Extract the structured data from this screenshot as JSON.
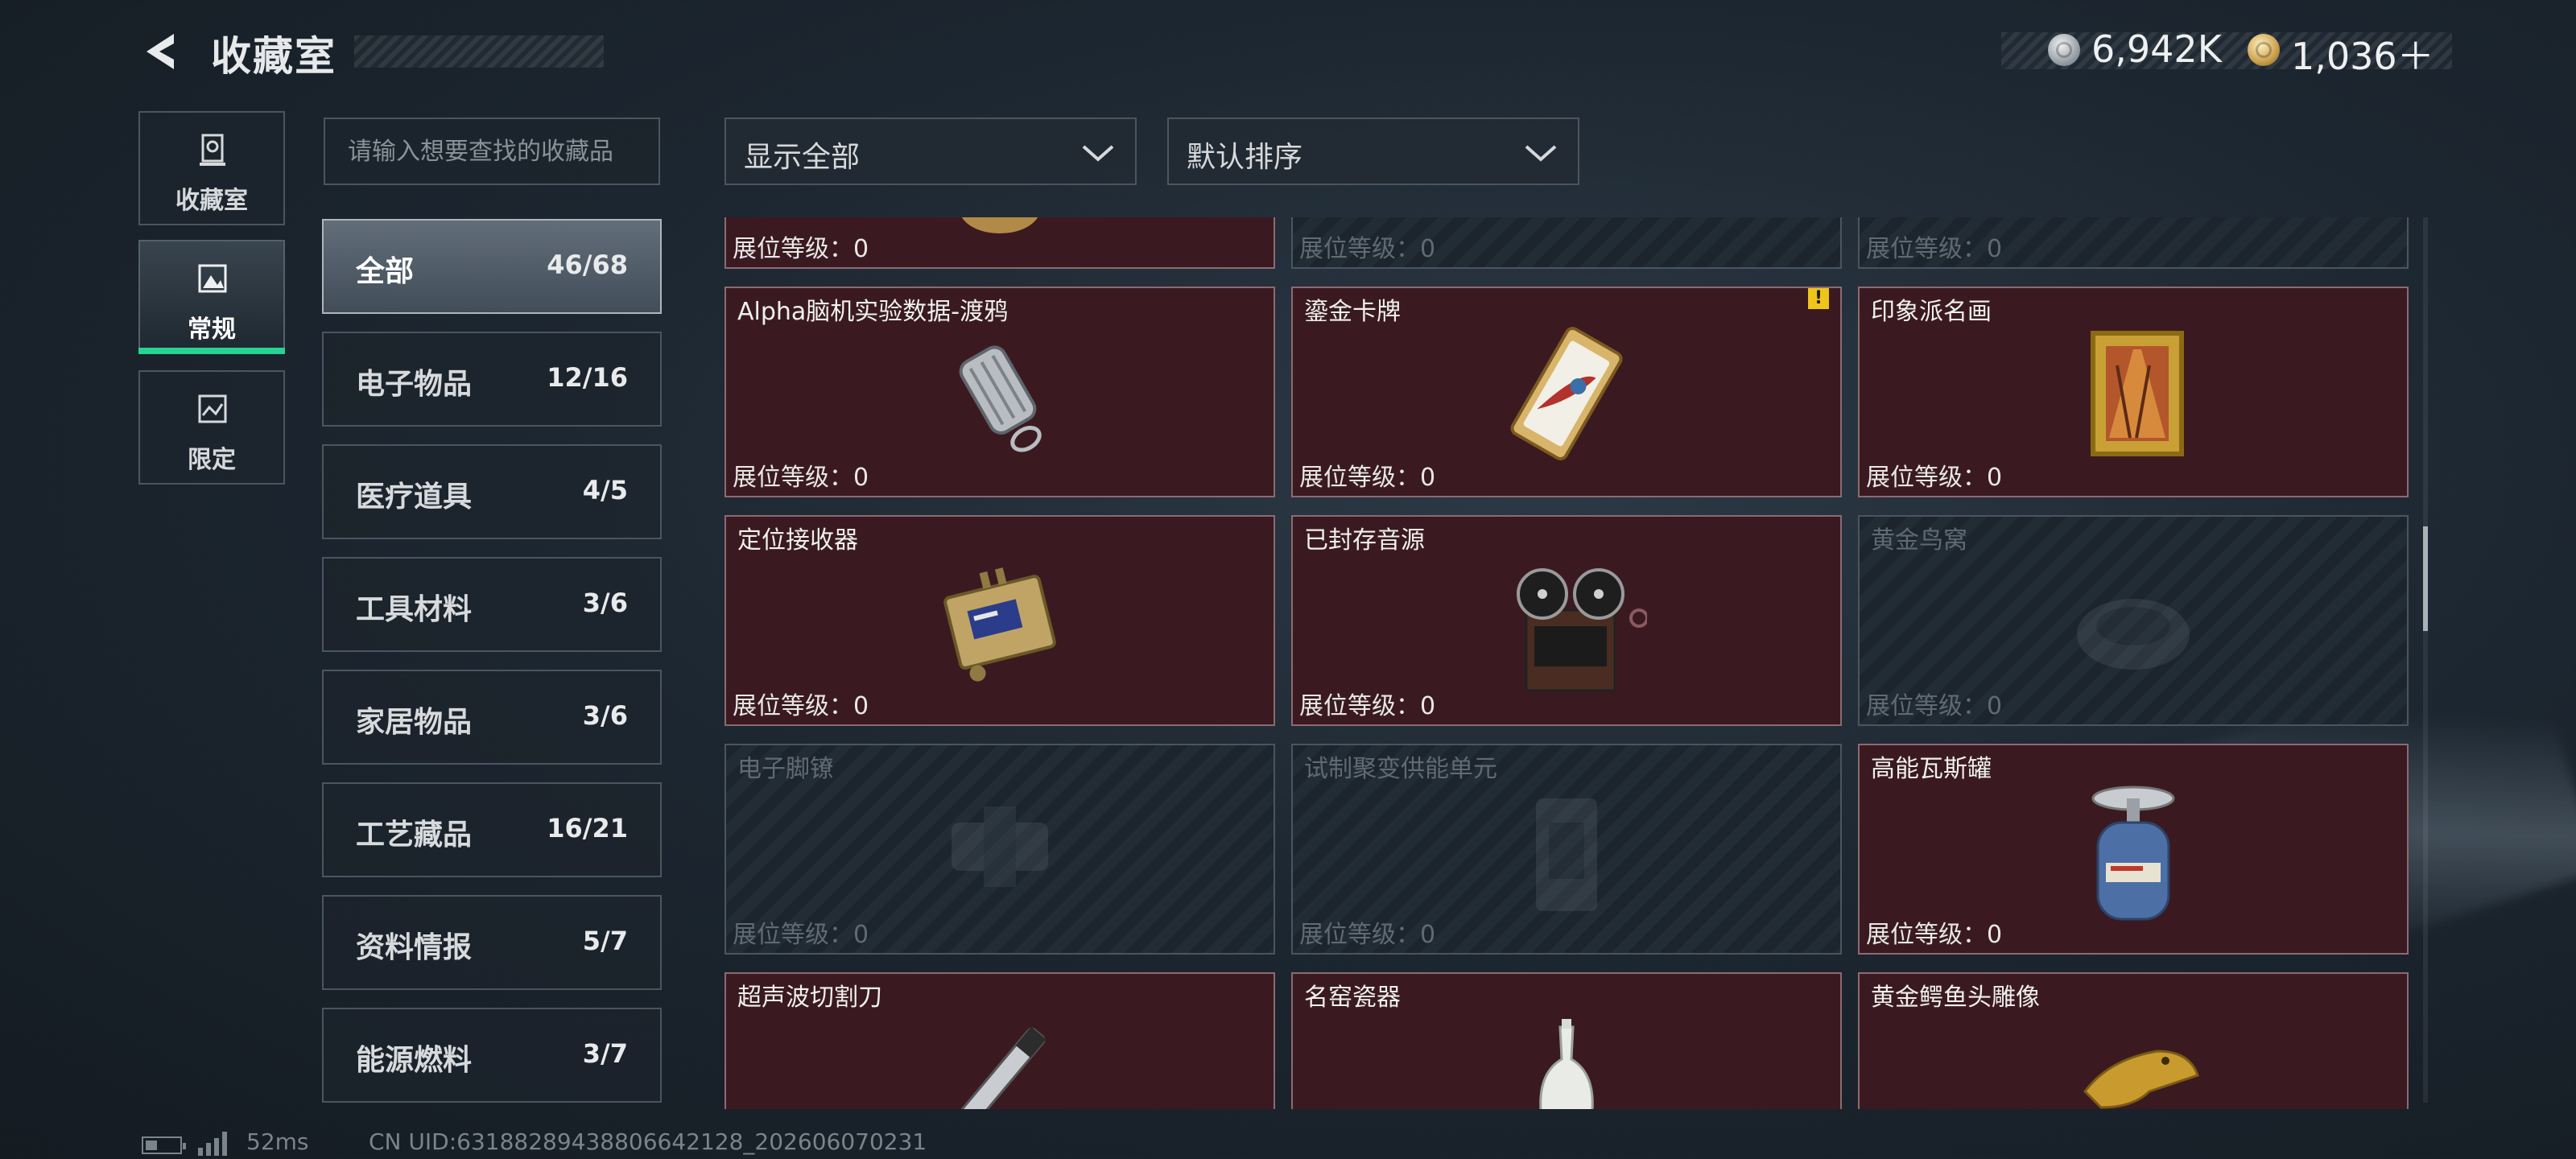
{
  "header": {
    "title": "收藏室",
    "currency_silver": "6,942K",
    "currency_gold": "1,036＋"
  },
  "side_tabs": [
    {
      "label": "收藏室",
      "icon": "trophy-icon"
    },
    {
      "label": "常规",
      "icon": "image-frame-icon",
      "active": true
    },
    {
      "label": "限定",
      "icon": "limited-frame-icon"
    }
  ],
  "search": {
    "placeholder": "请输入想要查找的收藏品"
  },
  "filters": {
    "display_label": "显示全部",
    "sort_label": "默认排序"
  },
  "categories": [
    {
      "name": "全部",
      "count": "46/68",
      "active": true
    },
    {
      "name": "电子物品",
      "count": "12/16"
    },
    {
      "name": "医疗道具",
      "count": "4/5"
    },
    {
      "name": "工具材料",
      "count": "3/6"
    },
    {
      "name": "家居物品",
      "count": "3/6"
    },
    {
      "name": "工艺藏品",
      "count": "16/21"
    },
    {
      "name": "资料情报",
      "count": "5/7"
    },
    {
      "name": "能源燃料",
      "count": "3/7"
    }
  ],
  "grid": {
    "level_label": "展位等级：0",
    "rows": [
      [
        {
          "name": "",
          "locked": false
        },
        {
          "name": "",
          "locked": true
        },
        {
          "name": "",
          "locked": true
        }
      ],
      [
        {
          "name": "Alpha脑机实验数据-渡鸦",
          "locked": false,
          "icon": "data-drive-icon"
        },
        {
          "name": "鎏金卡牌",
          "locked": false,
          "icon": "gilded-card-icon",
          "warning": "!"
        },
        {
          "name": "印象派名画",
          "locked": false,
          "icon": "framed-painting-icon"
        }
      ],
      [
        {
          "name": "定位接收器",
          "locked": false,
          "icon": "receiver-box-icon"
        },
        {
          "name": "已封存音源",
          "locked": false,
          "icon": "reel-recorder-icon"
        },
        {
          "name": "黄金鸟窝",
          "locked": true,
          "icon": "nest-icon"
        }
      ],
      [
        {
          "name": "电子脚镣",
          "locked": true,
          "icon": "ankle-monitor-icon"
        },
        {
          "name": "试制聚变供能单元",
          "locked": true,
          "icon": "fusion-unit-icon"
        },
        {
          "name": "高能瓦斯罐",
          "locked": false,
          "icon": "gas-canister-icon"
        }
      ],
      [
        {
          "name": "超声波切割刀",
          "locked": false,
          "icon": "ultrasonic-cutter-icon"
        },
        {
          "name": "名窑瓷器",
          "locked": false,
          "icon": "porcelain-vase-icon"
        },
        {
          "name": "黄金鳄鱼头雕像",
          "locked": false,
          "icon": "golden-croc-icon"
        }
      ]
    ]
  },
  "footer": {
    "ping": "52ms",
    "uid": "CN UID:631882894388066421​28_202606070231"
  }
}
